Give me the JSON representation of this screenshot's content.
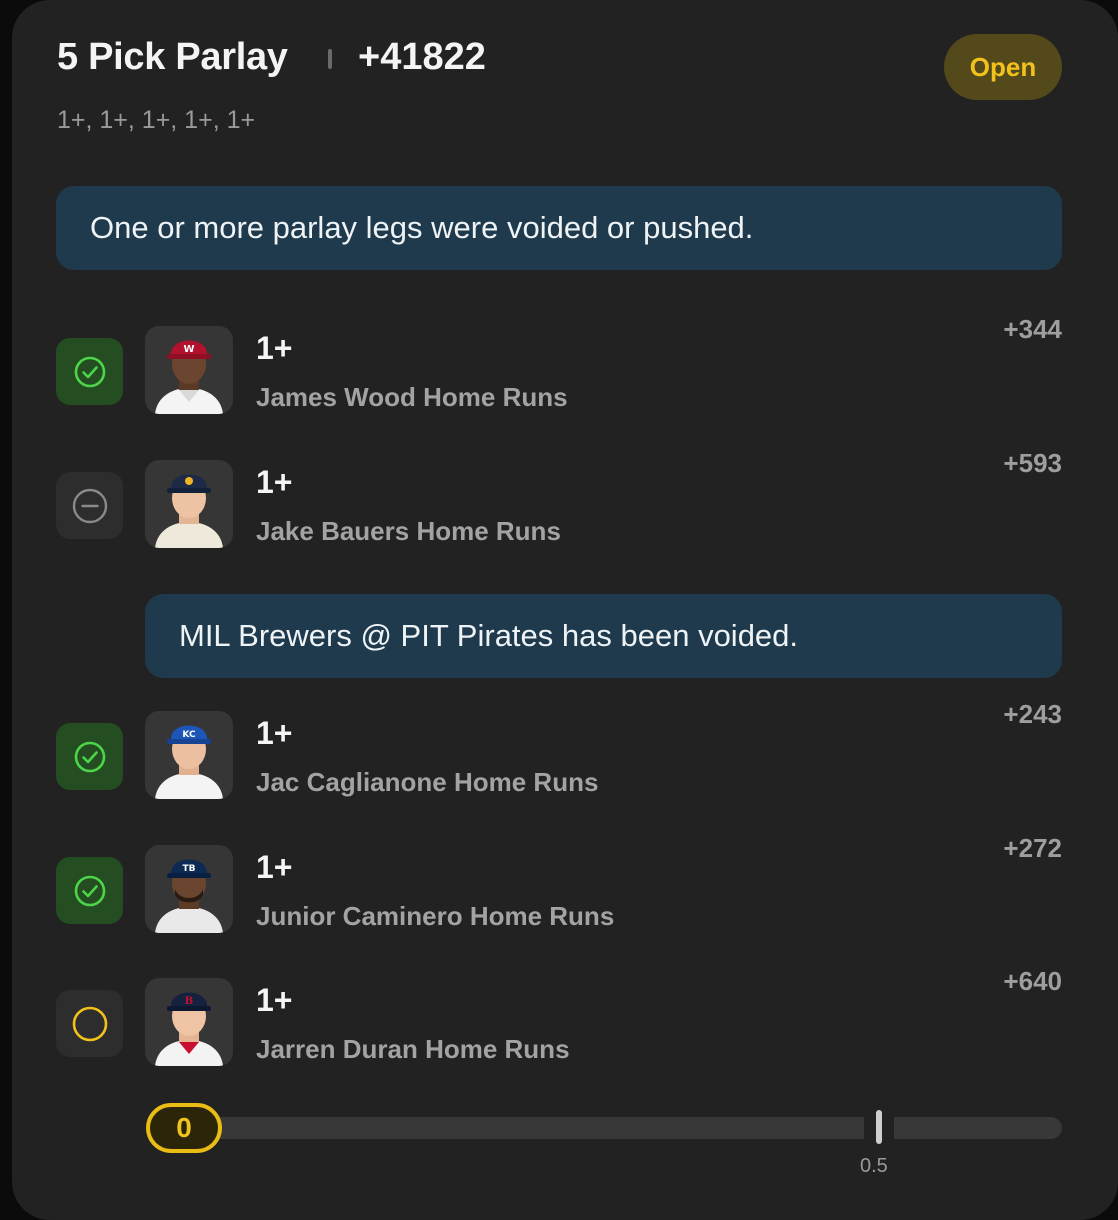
{
  "header": {
    "title": "5 Pick Parlay",
    "odds": "+41822",
    "subtitle": "1+, 1+, 1+, 1+, 1+",
    "status_badge": "Open"
  },
  "colors": {
    "card_bg": "#222223",
    "won_green": "#4cd548",
    "pending_yellow": "#f2c21b",
    "notice_bg": "#1f3a4c"
  },
  "notices": {
    "main": "One or more parlay legs were voided or pushed.",
    "game_void": "MIL Brewers @ PIT Pirates has been voided."
  },
  "legs": [
    {
      "line": "1+",
      "market": "James Wood Home Runs",
      "odds": "+344",
      "status": "won",
      "status_icon": "check-circle-icon",
      "team_cap_icon": "nationals-cap-icon"
    },
    {
      "line": "1+",
      "market": "Jake Bauers Home Runs",
      "odds": "+593",
      "status": "void",
      "status_icon": "minus-circle-icon",
      "team_cap_icon": "brewers-cap-icon"
    },
    {
      "line": "1+",
      "market": "Jac Caglianone Home Runs",
      "odds": "+243",
      "status": "won",
      "status_icon": "check-circle-icon",
      "team_cap_icon": "royals-cap-icon"
    },
    {
      "line": "1+",
      "market": "Junior Caminero Home Runs",
      "odds": "+272",
      "status": "won",
      "status_icon": "check-circle-icon",
      "team_cap_icon": "rays-cap-icon"
    },
    {
      "line": "1+",
      "market": "Jarren Duran Home Runs",
      "odds": "+640",
      "status": "pending",
      "status_icon": "empty-circle-icon",
      "team_cap_icon": "red-sox-cap-icon"
    }
  ],
  "progress": {
    "current": "0",
    "marker_label": "0.5"
  }
}
